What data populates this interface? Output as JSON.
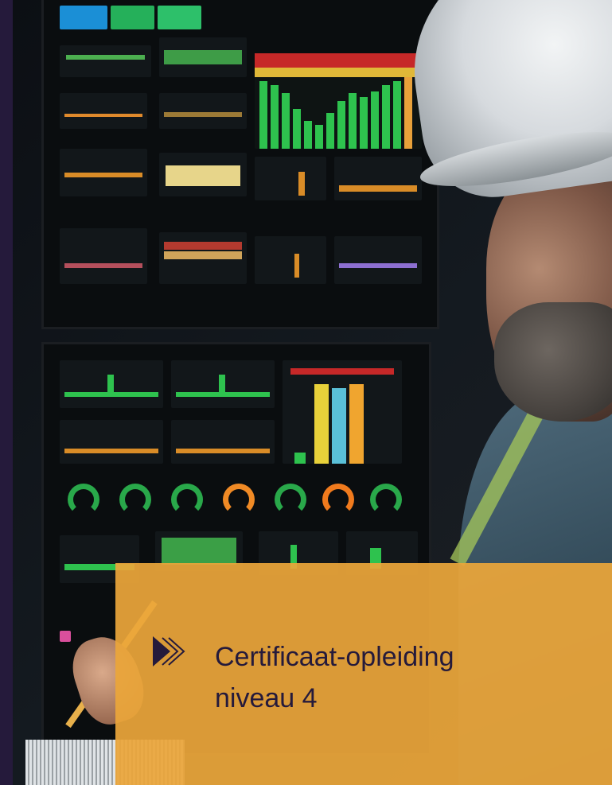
{
  "caption": {
    "line1": "Certificaat-opleiding",
    "line2": "niveau 4"
  },
  "icons": {
    "badge": "double-chevron-right-icon"
  },
  "colors": {
    "overlay": "#eba63a",
    "text": "#251a3b",
    "strip": "#251a3b"
  }
}
